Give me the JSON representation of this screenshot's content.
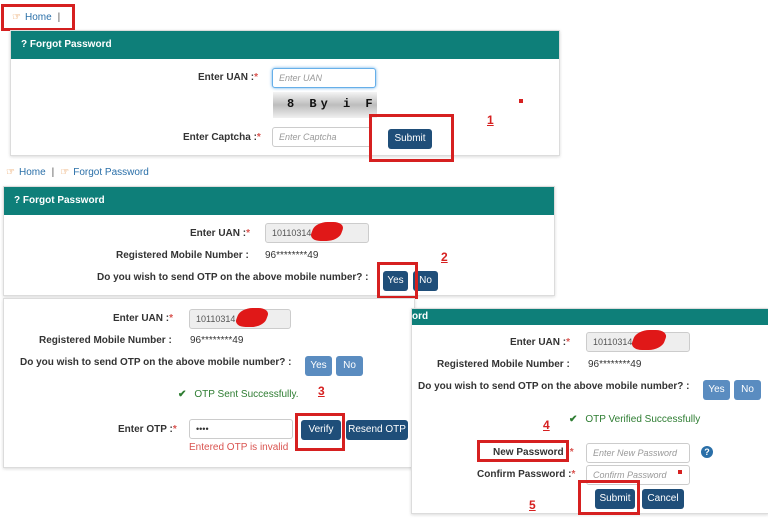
{
  "breadcrumb1": {
    "home": "Home",
    "sep": "|"
  },
  "panel1": {
    "title": "Forgot Password",
    "uan_label": "Enter UAN :",
    "uan_placeholder": "Enter UAN",
    "captcha_text": "8 By i F",
    "captcha_label": "Enter Captcha :",
    "captcha_placeholder": "Enter Captcha",
    "submit": "Submit",
    "step": "1"
  },
  "breadcrumb2": {
    "home": "Home",
    "sep": "|",
    "current": "Forgot Password"
  },
  "panel2": {
    "title": "Forgot Password",
    "uan_label": "Enter UAN :",
    "uan_value": "10110314",
    "mobile_label": "Registered Mobile Number :",
    "mobile_value": "96********49",
    "otp_question": "Do you wish to send OTP on the above mobile number? :",
    "yes": "Yes",
    "no": "No",
    "step": "2"
  },
  "panel3": {
    "uan_label": "Enter UAN :",
    "uan_value": "10110314",
    "mobile_label": "Registered Mobile Number :",
    "mobile_value": "96********49",
    "otp_question": "Do you wish to send OTP on the above mobile number? :",
    "yes": "Yes",
    "no": "No",
    "sent_msg": "OTP  Sent  Successfully.",
    "step": "3",
    "otp_label": "Enter OTP :",
    "otp_value": "••••",
    "verify": "Verify",
    "resend": "Resend OTP",
    "error": "Entered OTP is invalid"
  },
  "panel4": {
    "title_fragment": "ord",
    "uan_label": "Enter UAN :",
    "uan_value": "10110314",
    "mobile_label": "Registered Mobile Number :",
    "mobile_value": "96********49",
    "otp_question": "Do you wish to send OTP on the above mobile number? :",
    "yes": "Yes",
    "no": "No",
    "verified_msg": "OTP  Verified  Successfully",
    "step4": "4",
    "new_pw_label": "New Password :",
    "new_pw_placeholder": "Enter New Password",
    "confirm_pw_label": "Confirm Password :",
    "confirm_pw_placeholder": "Confirm Password",
    "submit": "Submit",
    "cancel": "Cancel",
    "step5": "5"
  },
  "colors": {
    "header": "#0e7f79",
    "button_dark": "#1f4e79",
    "button_light": "#5a8cc0",
    "highlight": "#d62020",
    "success": "#2e7d32",
    "error": "#d9534f"
  },
  "icons": {
    "home": "hand-pointing-icon",
    "help": "question-circle-icon",
    "check": "check-icon"
  }
}
